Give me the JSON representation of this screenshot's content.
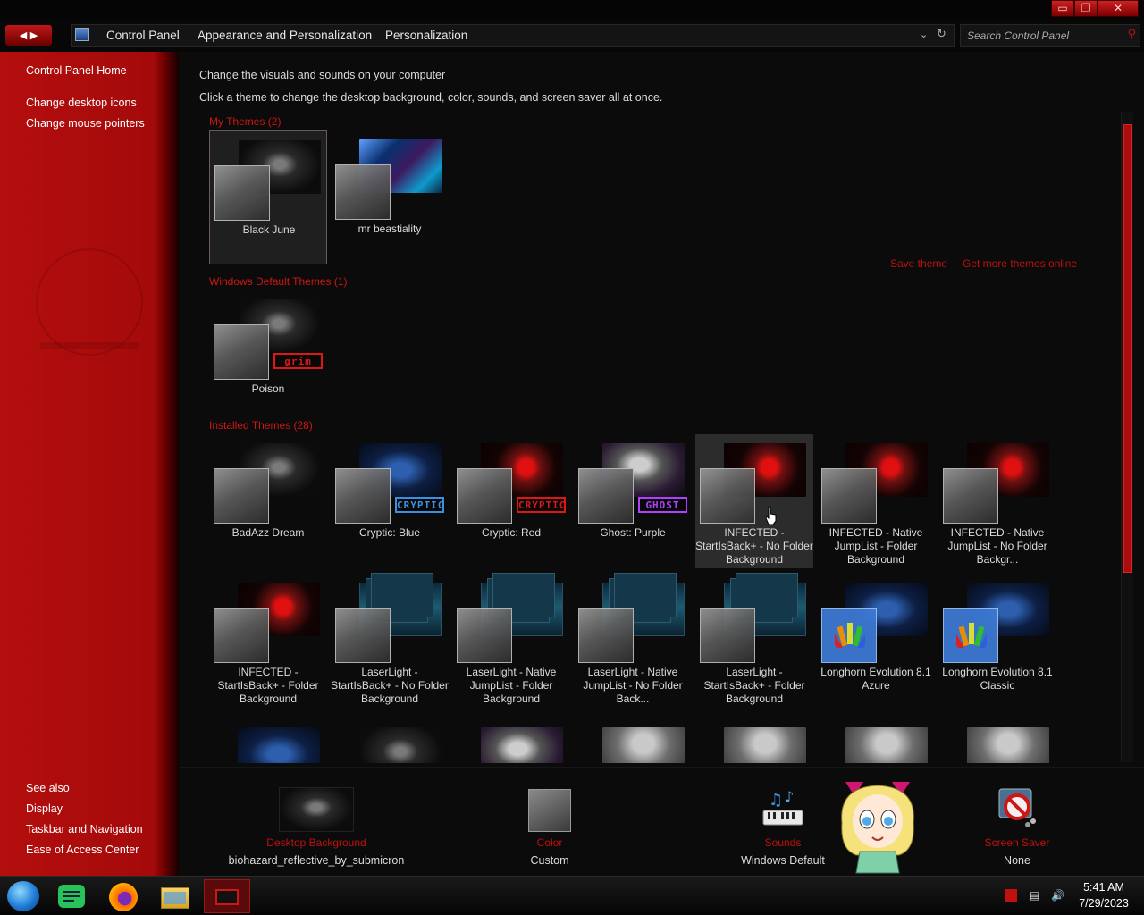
{
  "window": {
    "restore_glyph": "❐",
    "close_glyph": "✕",
    "minimize_glyph": "▭"
  },
  "address_bar": {
    "back_forward": "◀ ▶",
    "crumbs": [
      "Control Panel",
      "Appearance and Personalization",
      "Personalization"
    ],
    "dropdown_glyph": "⌄",
    "refresh_glyph": "↻",
    "search_placeholder": "Search Control Panel",
    "search_icon": "🔍"
  },
  "sidebar": {
    "home": "Control Panel Home",
    "tasks": [
      "Change desktop icons",
      "Change mouse pointers"
    ],
    "see_also_header": "See also",
    "see_also": [
      "Display",
      "Taskbar and Navigation",
      "Ease of Access Center"
    ]
  },
  "content": {
    "heading": "Change the visuals and sounds on your computer",
    "subheading": "Click a theme to change the desktop background, color, sounds, and screen saver all at once.",
    "save_theme": "Save theme",
    "get_more": "Get more themes online",
    "sections": {
      "my_themes": "My Themes (2)",
      "default_themes": "Windows Default Themes (1)",
      "installed_themes": "Installed Themes (28)"
    },
    "my_themes": [
      {
        "name": "Black June",
        "wall": "dark",
        "selected": true
      },
      {
        "name": "mr beastiality",
        "wall": "mrb"
      }
    ],
    "default_themes": [
      {
        "name": "Poison",
        "wall": "dark",
        "badge": "grim",
        "badge_color": "#e01515"
      }
    ],
    "installed_row1": [
      {
        "name": "BadAzz Dream",
        "wall": "dark"
      },
      {
        "name": "Cryptic: Blue",
        "wall": "blue",
        "badge": "CRYPTIC",
        "badge_color": "#3a8fe0"
      },
      {
        "name": "Cryptic: Red",
        "wall": "redglow",
        "badge": "CRYPTIC",
        "badge_color": "#e01515"
      },
      {
        "name": "Ghost: Purple",
        "wall": "purple",
        "badge": "GHOST",
        "badge_color": "#b040ff"
      },
      {
        "name": "INFECTED - StartIsBack+ - No Folder Background",
        "wall": "redglow",
        "hover": true
      },
      {
        "name": "INFECTED - Native JumpList - Folder Background",
        "wall": "redglow"
      },
      {
        "name": "INFECTED - Native JumpList - No Folder Backgr...",
        "wall": "redglow"
      }
    ],
    "installed_row2": [
      {
        "name": "INFECTED - StartIsBack+ - Folder Background",
        "wall": "redglow"
      },
      {
        "name": "LaserLight - StartIsBack+ - No Folder Background",
        "wall": "laser"
      },
      {
        "name": "LaserLight - Native JumpList - Folder Background",
        "wall": "laser"
      },
      {
        "name": "LaserLight - Native JumpList - No Folder Back...",
        "wall": "laser"
      },
      {
        "name": "LaserLight - StartIsBack+ - Folder Background",
        "wall": "laser"
      },
      {
        "name": "Longhorn Evolution 8.1 Azure",
        "wall": "blue",
        "rainbow": true
      },
      {
        "name": "Longhorn Evolution 8.1 Classic",
        "wall": "blue",
        "rainbow": true
      }
    ],
    "installed_row3": [
      "blue",
      "dark",
      "purple",
      "grey",
      "grey",
      "grey",
      "grey"
    ]
  },
  "bottom": {
    "desktop_background_label": "Desktop Background",
    "desktop_background_value": "biohazard_reflective_by_submicron",
    "color_label": "Color",
    "color_value": "Custom",
    "sounds_label": "Sounds",
    "sounds_value": "Windows Default",
    "screensaver_label": "Screen Saver",
    "screensaver_value": "None"
  },
  "taskbar": {
    "time": "5:41 AM",
    "date": "7/29/2023",
    "icons": [
      "start-orb-icon",
      "chat-icon",
      "firefox-icon",
      "file-explorer-icon",
      "personalization-icon"
    ]
  },
  "colors": {
    "accent": "#c01010",
    "sidebar": "#b40e0e",
    "background": "#0b0b0b"
  }
}
